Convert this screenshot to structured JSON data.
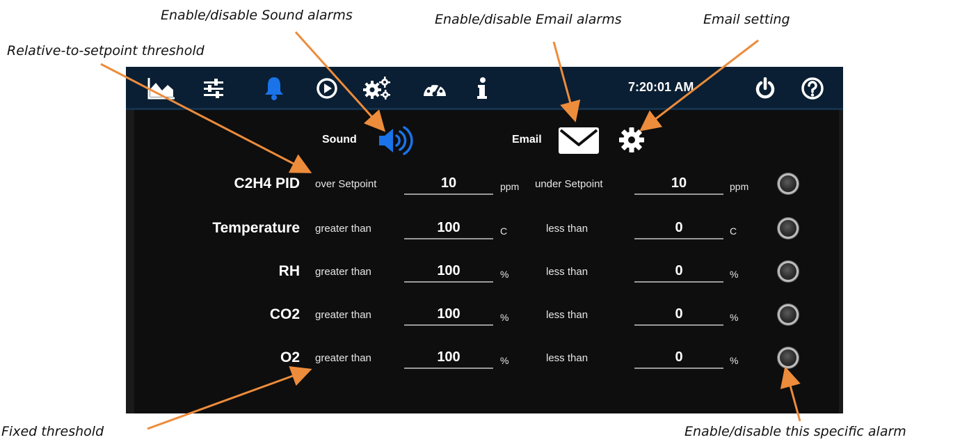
{
  "annotations": {
    "sound": "Enable/disable Sound alarms",
    "email": "Enable/disable Email alarms",
    "email_setting": "Email setting",
    "relative": "Relative-to-setpoint threshold",
    "fixed": "Fixed threshold",
    "specific": "Enable/disable this specific alarm"
  },
  "topbar": {
    "icons": [
      "chart-icon",
      "sliders-icon",
      "bell-icon",
      "play-circle-icon",
      "gears-icon",
      "gauge-icon",
      "info-icon"
    ],
    "active_icon": "bell-icon",
    "time": "7:20:01 AM",
    "right_icons": [
      "power-icon",
      "help-icon"
    ]
  },
  "controls": {
    "sound_label": "Sound",
    "email_label": "Email"
  },
  "colors": {
    "topbar": "#0a1f33",
    "panel": "#0e0e0e",
    "accent": "#1a73e8",
    "annotation_arrow": "#ed8c3b"
  },
  "alarms": [
    {
      "name": "C2H4 PID",
      "high_label": "over Setpoint",
      "high_value": "10",
      "high_unit": "ppm",
      "low_label": "under Setpoint",
      "low_value": "10",
      "low_unit": "ppm"
    },
    {
      "name": "Temperature",
      "high_label": "greater than",
      "high_value": "100",
      "high_unit": "C",
      "low_label": "less than",
      "low_value": "0",
      "low_unit": "C"
    },
    {
      "name": "RH",
      "high_label": "greater than",
      "high_value": "100",
      "high_unit": "%",
      "low_label": "less than",
      "low_value": "0",
      "low_unit": "%"
    },
    {
      "name": "CO2",
      "high_label": "greater than",
      "high_value": "100",
      "high_unit": "%",
      "low_label": "less than",
      "low_value": "0",
      "low_unit": "%"
    },
    {
      "name": "O2",
      "high_label": "greater than",
      "high_value": "100",
      "high_unit": "%",
      "low_label": "less than",
      "low_value": "0",
      "low_unit": "%"
    }
  ]
}
